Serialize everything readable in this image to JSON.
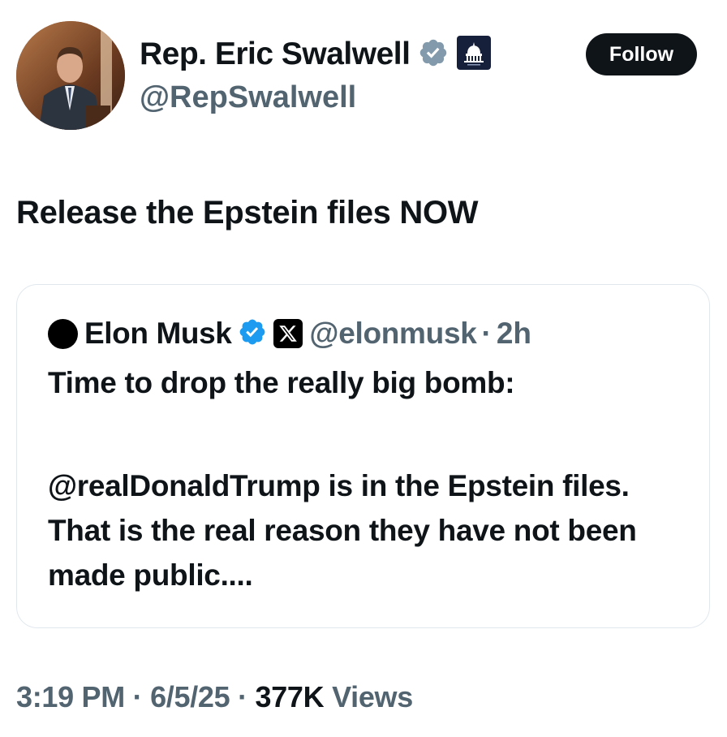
{
  "author": {
    "display_name": "Rep. Eric Swalwell",
    "handle": "@RepSwalwell",
    "verified_badge": "gray-check-badge",
    "affiliate_badge": "capitol-dome-badge"
  },
  "follow_button": {
    "label": "Follow"
  },
  "tweet": {
    "text": "Release the Epstein files NOW"
  },
  "quoted": {
    "display_name": "Elon Musk",
    "verified_badge": "blue-check-badge",
    "affiliate_badge": "x-logo-badge",
    "handle": "@elonmusk",
    "separator": "·",
    "time": "2h",
    "line1": "Time to drop the really big bomb:",
    "paragraph": "@realDonaldTrump is in the Epstein files. That is the real reason they have not been made public...."
  },
  "footer": {
    "time": "3:19 PM",
    "sep1": "·",
    "date": "6/5/25",
    "sep2": "·",
    "views_count": "377K",
    "views_label": "Views"
  },
  "colors": {
    "text": "#0f1419",
    "muted": "#536471",
    "verified_blue": "#1d9bf0",
    "verified_gray": "#829aab",
    "card_border": "#e1e8ed"
  }
}
